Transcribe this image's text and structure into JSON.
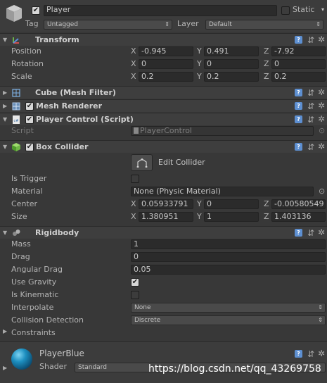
{
  "object": {
    "active": true,
    "name": "Player",
    "static_label": "Static",
    "tag_label": "Tag",
    "tag_value": "Untagged",
    "layer_label": "Layer",
    "layer_value": "Default"
  },
  "transform": {
    "title": "Transform",
    "position_label": "Position",
    "rotation_label": "Rotation",
    "scale_label": "Scale",
    "x": "X",
    "y": "Y",
    "z": "Z",
    "position": [
      "-0.945",
      "0.491",
      "-7.92"
    ],
    "rotation": [
      "0",
      "0",
      "0"
    ],
    "scale": [
      "0.2",
      "0.2",
      "0.2"
    ]
  },
  "mesh_filter": {
    "title": "Cube (Mesh Filter)"
  },
  "mesh_renderer": {
    "title": "Mesh Renderer",
    "enabled": true
  },
  "player_control": {
    "title": "Player Control (Script)",
    "enabled": true,
    "script_label": "Script",
    "script_value": "PlayerControl"
  },
  "box_collider": {
    "title": "Box Collider",
    "enabled": true,
    "edit_label": "Edit Collider",
    "is_trigger_label": "Is Trigger",
    "is_trigger": false,
    "material_label": "Material",
    "material_value": "None (Physic Material)",
    "center_label": "Center",
    "center": [
      "0.05933791",
      "0",
      "-0.00580549"
    ],
    "size_label": "Size",
    "size": [
      "1.380951",
      "1",
      "1.403136"
    ]
  },
  "rigidbody": {
    "title": "Rigidbody",
    "mass_label": "Mass",
    "mass": "1",
    "drag_label": "Drag",
    "drag": "0",
    "angular_drag_label": "Angular Drag",
    "angular_drag": "0.05",
    "use_gravity_label": "Use Gravity",
    "use_gravity": true,
    "is_kinematic_label": "Is Kinematic",
    "is_kinematic": false,
    "interpolate_label": "Interpolate",
    "interpolate": "None",
    "collision_label": "Collision Detection",
    "collision": "Discrete",
    "constraints_label": "Constraints"
  },
  "material": {
    "name": "PlayerBlue",
    "shader_label": "Shader",
    "shader_value": "Standard"
  },
  "watermark": "https://blog.csdn.net/qq_43269758",
  "colors": {
    "background": "#383838",
    "field": "#2b2b2b",
    "accent": "#5d8fd1"
  }
}
